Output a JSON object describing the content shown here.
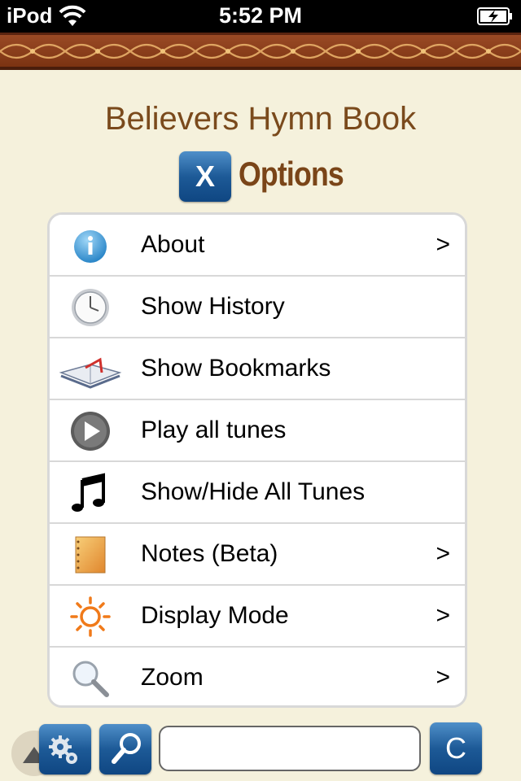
{
  "status_bar": {
    "carrier": "iPod",
    "time": "5:52 PM"
  },
  "app_title": "Believers Hymn Book",
  "options": {
    "close_label": "X",
    "title": "Options"
  },
  "menu": [
    {
      "icon": "info-icon",
      "label": "About",
      "chevron": ">"
    },
    {
      "icon": "clock-icon",
      "label": "Show History",
      "chevron": ""
    },
    {
      "icon": "bookmark-book-icon",
      "label": "Show Bookmarks",
      "chevron": ""
    },
    {
      "icon": "play-icon",
      "label": "Play all tunes",
      "chevron": ""
    },
    {
      "icon": "music-note-icon",
      "label": "Show/Hide All Tunes",
      "chevron": ""
    },
    {
      "icon": "notepad-icon",
      "label": "Notes (Beta)",
      "chevron": ">"
    },
    {
      "icon": "sun-icon",
      "label": "Display Mode",
      "chevron": ">"
    },
    {
      "icon": "magnifier-icon",
      "label": "Zoom",
      "chevron": ">"
    }
  ],
  "toolbar": {
    "search_value": "",
    "clear_label": "C"
  },
  "colors": {
    "background": "#f5f1dc",
    "title_brown": "#7a4a1c",
    "button_blue": "#1d5a97",
    "ornament": "#7b3312"
  }
}
